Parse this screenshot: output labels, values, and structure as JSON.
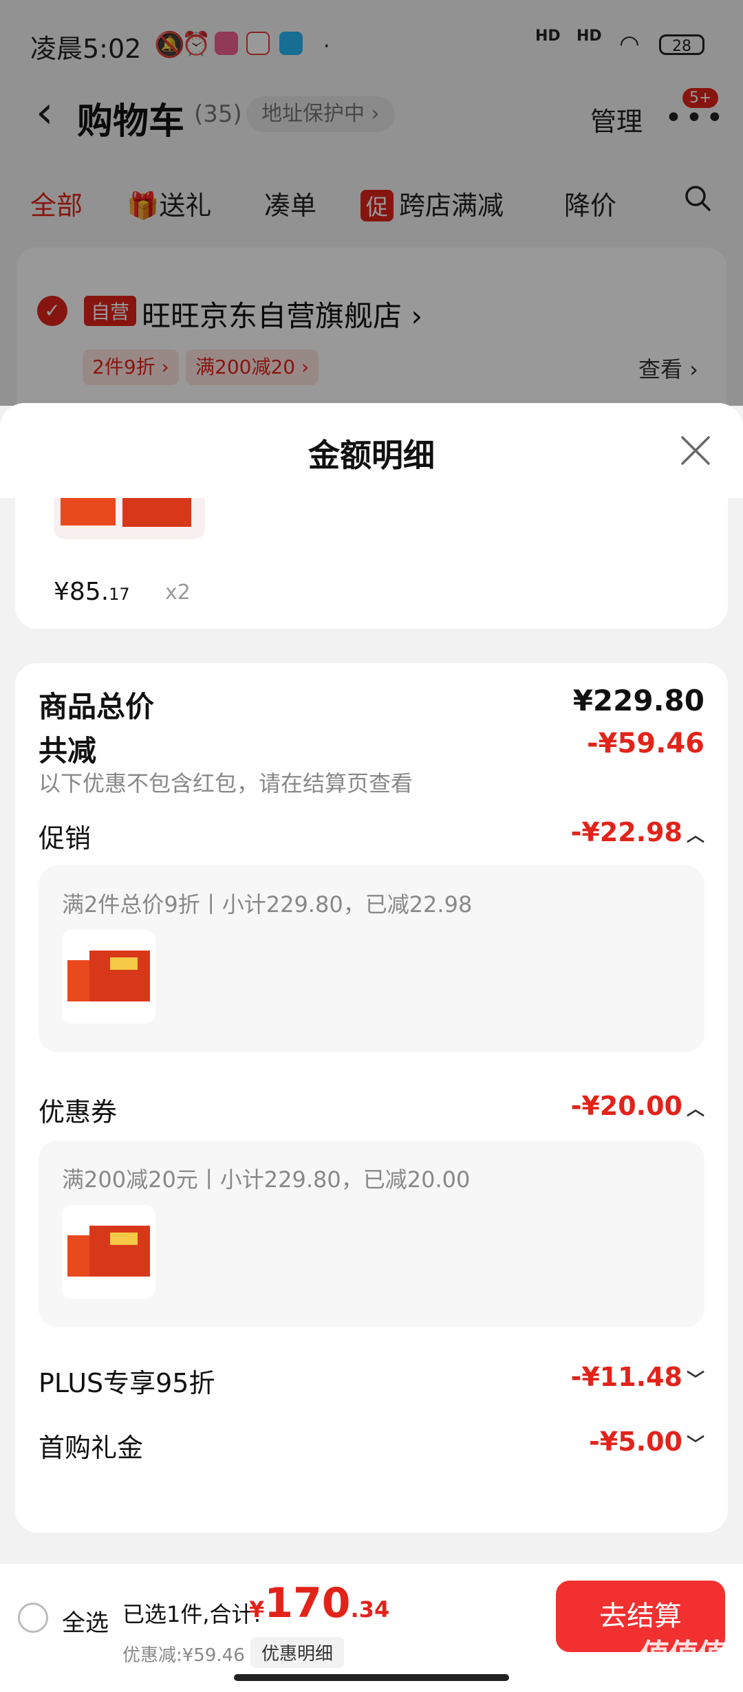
{
  "status_bar": {
    "time": "凌晨5:02",
    "battery": "28",
    "hd1": "HD",
    "hd2": "HD"
  },
  "nav": {
    "title": "购物车",
    "count": "(35)",
    "address_protect": "地址保护中 ›",
    "manage": "管理",
    "badge": "5+"
  },
  "tabs": [
    {
      "label": "全部",
      "active": true
    },
    {
      "label": "送礼"
    },
    {
      "label": "凑单"
    },
    {
      "label": "跨店满减",
      "chip": "促"
    },
    {
      "label": "降价"
    }
  ],
  "store": {
    "self_tag": "自营",
    "name": "旺旺京东自营旗舰店 ›",
    "coupons": [
      "2件9折 ›",
      "满200减20 ›"
    ],
    "view": "查看 ›"
  },
  "sheet": {
    "title": "金额明细",
    "product": {
      "price_int": "¥85.",
      "price_dec": "17",
      "qty": "x2"
    },
    "goods_total_label": "商品总价",
    "goods_total": "¥229.80",
    "discount_label": "共减",
    "discount_total": "-¥59.46",
    "discount_note": "以下优惠不包含红包，请在结算页查看",
    "promo_label": "促销",
    "promo_amount": "-¥22.98",
    "promo_detail": "满2件总价9折丨小计229.80，已减22.98",
    "coupon_label": "优惠券",
    "coupon_amount": "-¥20.00",
    "coupon_detail": "满200减20元丨小计229.80，已减20.00",
    "plus_label": "PLUS专享95折",
    "plus_amount": "-¥11.48",
    "first_label": "首购礼金",
    "first_amount": "-¥5.00"
  },
  "bottom": {
    "select_all": "全选",
    "selected": "已选1件,合计:",
    "currency": "¥",
    "total_int": "170",
    "total_dec": ".34",
    "saved": "优惠减:¥59.46",
    "detail_btn": "优惠明细",
    "checkout": "去结算"
  },
  "watermark": "值值值",
  "colors": {
    "accent": "#e2231a",
    "checkout": "#f23030"
  }
}
